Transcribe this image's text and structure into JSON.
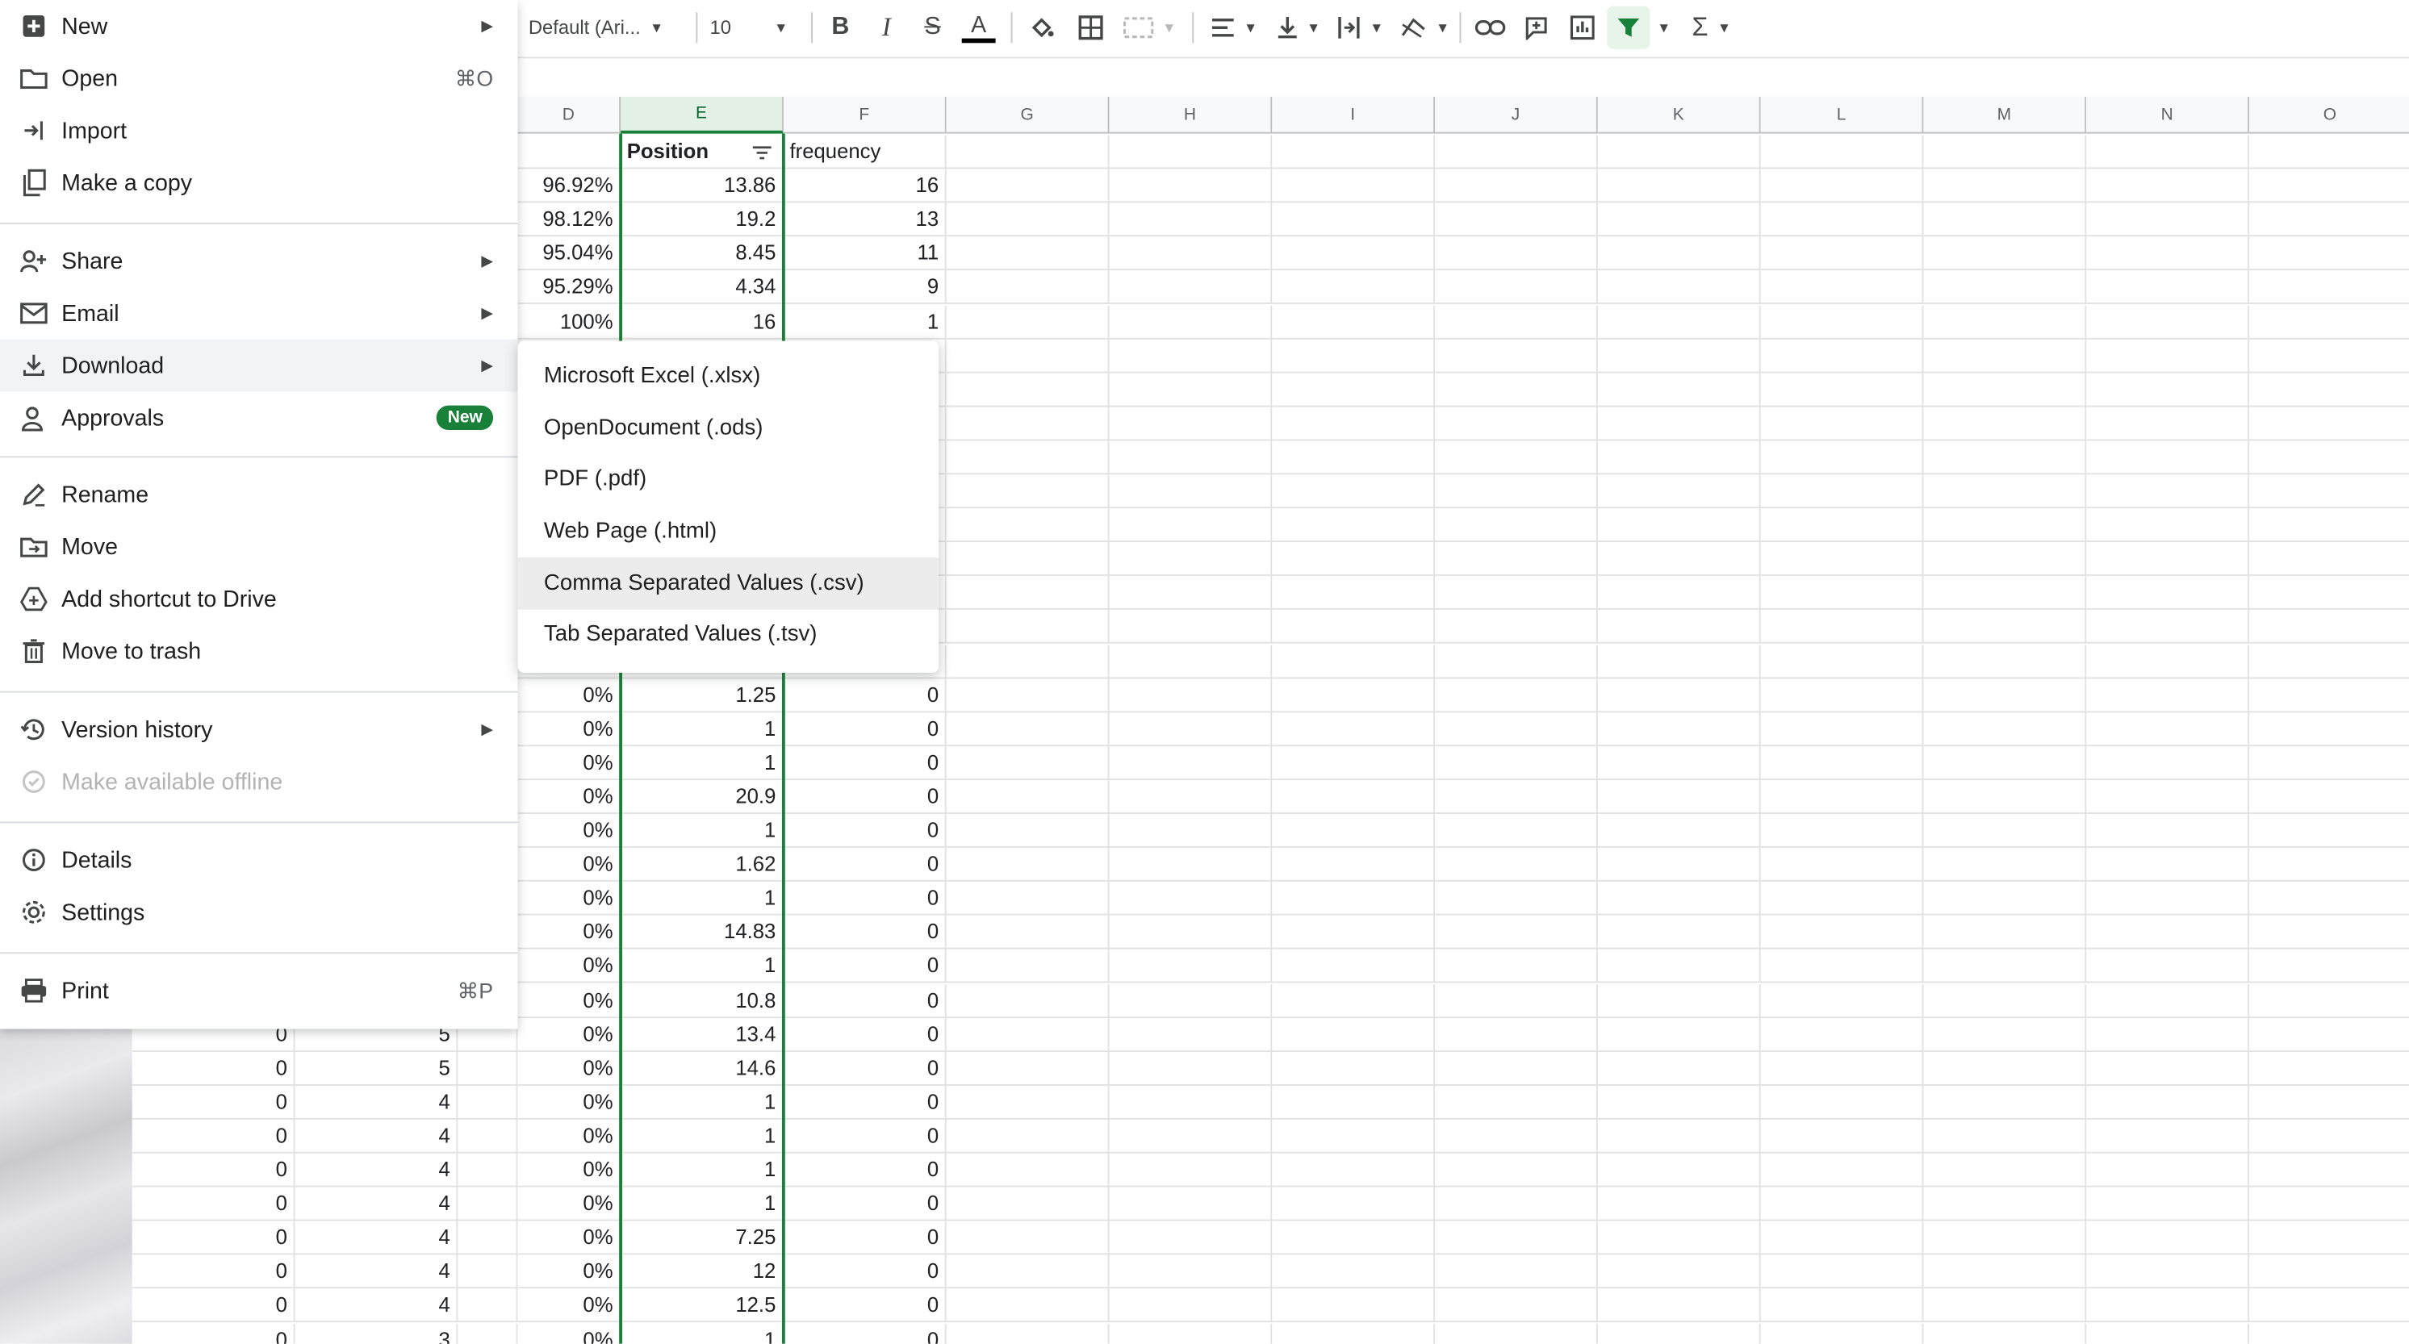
{
  "toolbar": {
    "font_family": "Default (Ari...",
    "font_size": "10"
  },
  "grid": {
    "columns": [
      "D",
      "E",
      "F",
      "G",
      "H",
      "I",
      "J",
      "K",
      "L",
      "M",
      "N",
      "O"
    ],
    "header_row": {
      "d": "",
      "e": "Position",
      "f": "frequency"
    },
    "top_rows": [
      {
        "d": "96.92%",
        "e": "13.86",
        "f": "16"
      },
      {
        "d": "98.12%",
        "e": "19.2",
        "f": "13"
      },
      {
        "d": "95.04%",
        "e": "8.45",
        "f": "11"
      },
      {
        "d": "95.29%",
        "e": "4.34",
        "f": "9"
      },
      {
        "d": "100%",
        "e": "16",
        "f": "1"
      }
    ],
    "mid_rows": [
      {
        "d": "0%",
        "e": "1.25",
        "f": "0"
      },
      {
        "d": "0%",
        "e": "1",
        "f": "0"
      },
      {
        "d": "0%",
        "e": "1",
        "f": "0"
      },
      {
        "d": "0%",
        "e": "20.9",
        "f": "0"
      },
      {
        "d": "0%",
        "e": "1",
        "f": "0"
      },
      {
        "d": "0%",
        "e": "1.62",
        "f": "0"
      },
      {
        "d": "0%",
        "e": "1",
        "f": "0"
      },
      {
        "d": "0%",
        "e": "14.83",
        "f": "0"
      },
      {
        "d": "0%",
        "e": "1",
        "f": "0"
      },
      {
        "d": "0%",
        "e": "10.8",
        "f": "0"
      }
    ],
    "bottom_rows": [
      {
        "b": "0",
        "c": "5",
        "d": "0%",
        "e": "13.4",
        "f": "0"
      },
      {
        "b": "0",
        "c": "5",
        "d": "0%",
        "e": "14.6",
        "f": "0"
      },
      {
        "b": "0",
        "c": "4",
        "d": "0%",
        "e": "1",
        "f": "0"
      },
      {
        "b": "0",
        "c": "4",
        "d": "0%",
        "e": "1",
        "f": "0"
      },
      {
        "b": "0",
        "c": "4",
        "d": "0%",
        "e": "1",
        "f": "0"
      },
      {
        "b": "0",
        "c": "4",
        "d": "0%",
        "e": "1",
        "f": "0"
      },
      {
        "b": "0",
        "c": "4",
        "d": "0%",
        "e": "7.25",
        "f": "0"
      },
      {
        "b": "0",
        "c": "4",
        "d": "0%",
        "e": "12",
        "f": "0"
      },
      {
        "b": "0",
        "c": "4",
        "d": "0%",
        "e": "12.5",
        "f": "0"
      },
      {
        "b": "0",
        "c": "3",
        "d": "0%",
        "e": "1",
        "f": "0"
      }
    ]
  },
  "file_menu": {
    "new": "New",
    "open": "Open",
    "open_shortcut": "⌘O",
    "import": "Import",
    "make_copy": "Make a copy",
    "share": "Share",
    "email": "Email",
    "download": "Download",
    "approvals": "Approvals",
    "approvals_badge": "New",
    "rename": "Rename",
    "move": "Move",
    "add_shortcut": "Add shortcut to Drive",
    "trash": "Move to trash",
    "version_history": "Version history",
    "offline": "Make available offline",
    "details": "Details",
    "settings": "Settings",
    "print": "Print",
    "print_shortcut": "⌘P"
  },
  "download_submenu": [
    "Microsoft Excel (.xlsx)",
    "OpenDocument (.ods)",
    "PDF (.pdf)",
    "Web Page (.html)",
    "Comma Separated Values (.csv)",
    "Tab Separated Values (.tsv)"
  ],
  "colors": {
    "accent_green": "#188038",
    "badge_green": "#188038"
  }
}
